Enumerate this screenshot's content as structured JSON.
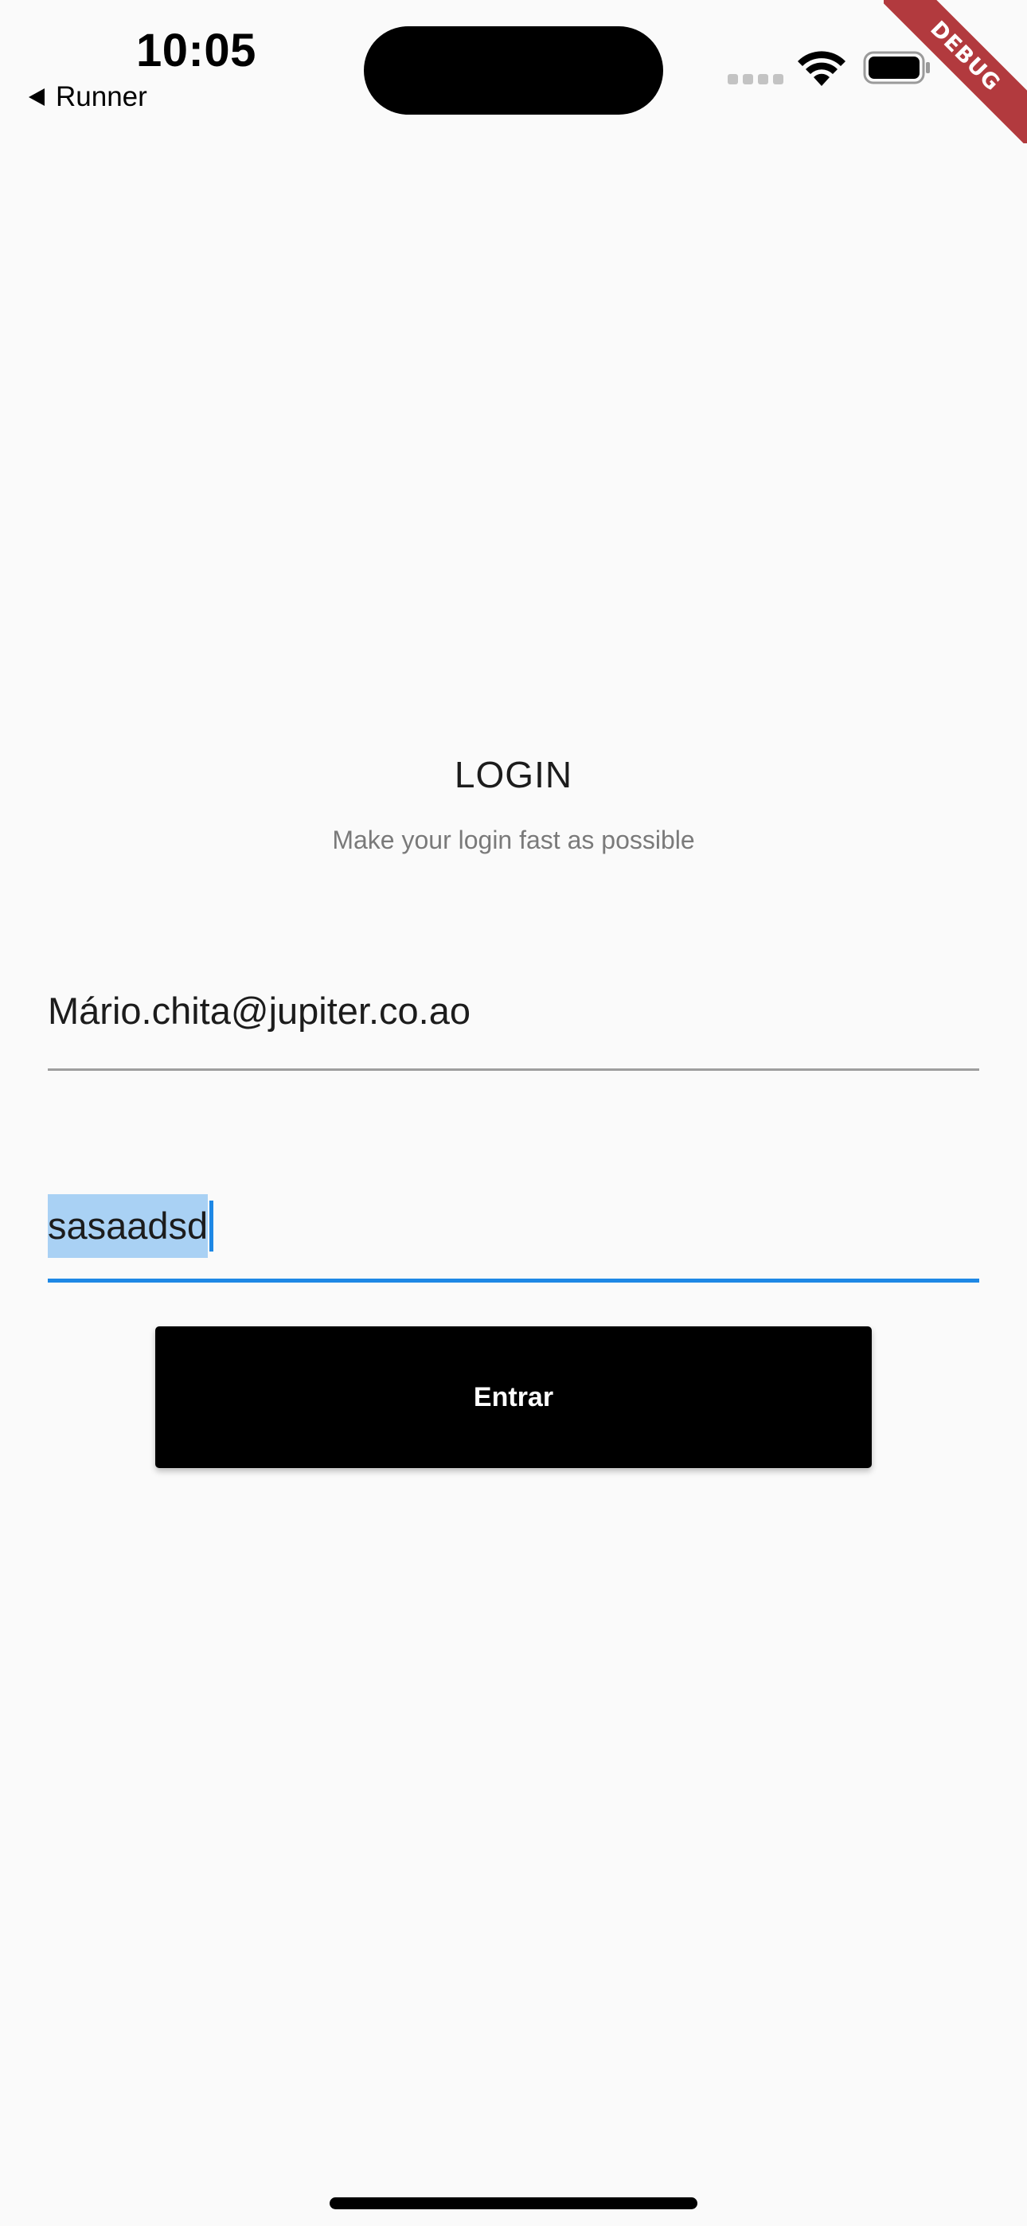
{
  "status_bar": {
    "time": "10:05",
    "back_app_label": "Runner"
  },
  "debug_banner": "DEBUG",
  "login": {
    "title": "LOGIN",
    "subtitle": "Make your login fast as possible",
    "email_value": "Mário.chita@jupiter.co.ao",
    "password_value": "sasaadsd",
    "submit_label": "Entrar"
  },
  "colors": {
    "background": "#fafafa",
    "button": "#000000",
    "focus_underline": "#1e88e5",
    "selection": "#a9d1f4",
    "debug_ribbon": "#b23a3e"
  },
  "icons": [
    "back-arrow-icon",
    "cellular-signal-icon",
    "wifi-icon",
    "battery-icon"
  ]
}
